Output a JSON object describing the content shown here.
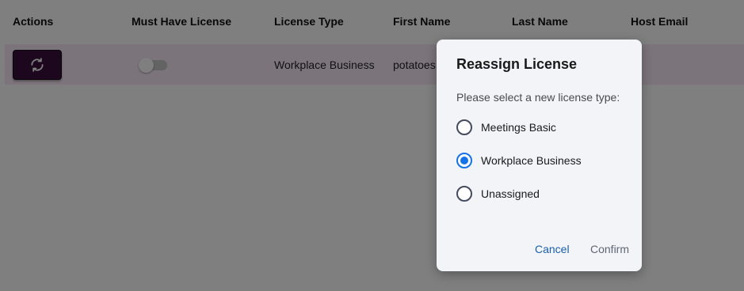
{
  "table": {
    "columns": [
      "Actions",
      "Must Have License",
      "License Type",
      "First Name",
      "Last Name",
      "Host Email"
    ],
    "rows": [
      {
        "must_have_license": false,
        "license_type": "Workplace Business",
        "first_name": "potatoes",
        "last_name": "",
        "host_email": ""
      }
    ]
  },
  "dialog": {
    "title": "Reassign License",
    "prompt": "Please select a new license type:",
    "options": [
      {
        "label": "Meetings Basic",
        "selected": false
      },
      {
        "label": "Workplace Business",
        "selected": true
      },
      {
        "label": "Unassigned",
        "selected": false
      }
    ],
    "cancel_label": "Cancel",
    "confirm_label": "Confirm"
  },
  "colors": {
    "action_button": "#3a0f3c",
    "row_highlight": "#f7e8f7",
    "link_blue": "#1473e6",
    "cancel_blue": "#1a5fa8",
    "overlay": "rgba(0,0,0,0.5)"
  },
  "icons": {
    "reassign": "refresh-icon"
  }
}
